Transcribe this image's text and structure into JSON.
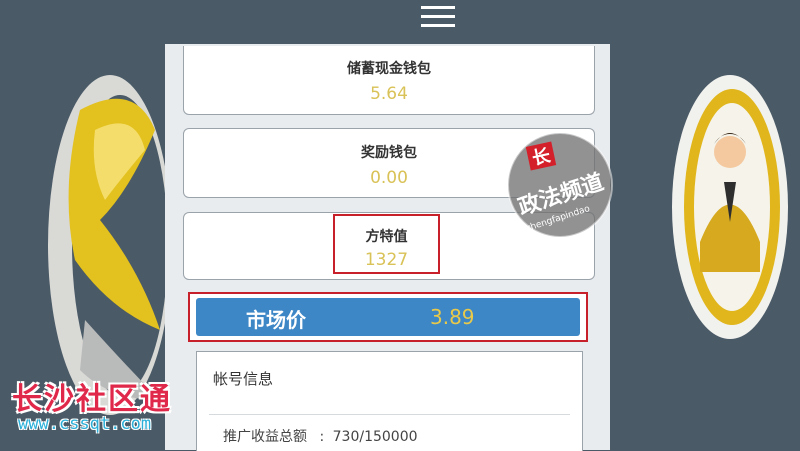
{
  "header": {
    "menu_icon": "hamburger-menu-icon"
  },
  "wallets": {
    "savings_cash": {
      "title": "储蓄现金钱包",
      "value": "5.64"
    },
    "reward": {
      "title": "奖励钱包",
      "value": "0.00"
    },
    "fangte": {
      "title": "方特值",
      "value": "1327"
    }
  },
  "market": {
    "label": "市场价",
    "value": "3.89"
  },
  "account": {
    "heading": "帐号信息",
    "promo_label": "推广收益总额",
    "promo_sep": ":",
    "promo_value": "730/150000"
  },
  "watermarks": {
    "circle_line1": "政法频道",
    "circle_line2": "zhengfapindao",
    "bottom_cn": "长沙社区通",
    "bottom_url": "www.cssqt.com"
  },
  "colors": {
    "accent_blue": "#3e87c6",
    "value_gold": "#d9c257",
    "highlight_red": "#c8202a"
  }
}
